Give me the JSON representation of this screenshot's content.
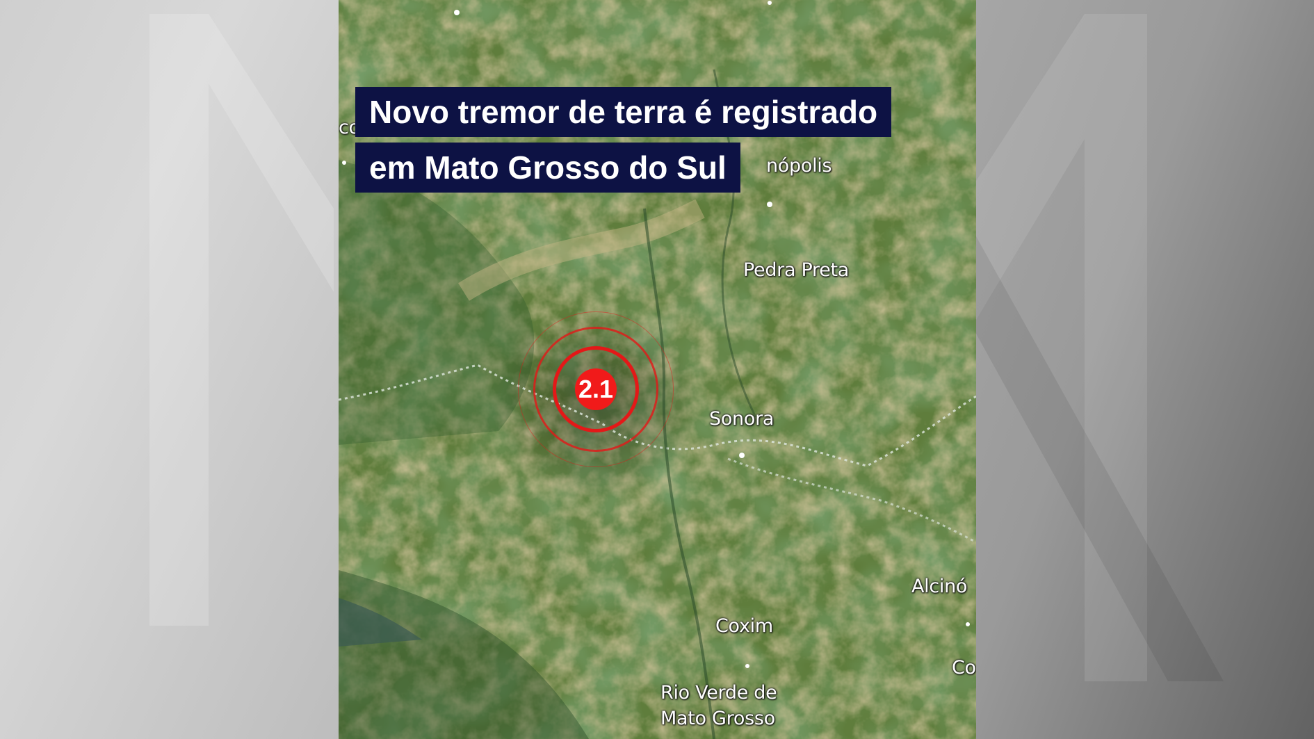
{
  "headline": {
    "line1": "Novo tremor de terra é registrado",
    "line2": "em Mato Grosso do Sul"
  },
  "earthquake": {
    "magnitude": "2.1",
    "marker_color": "#f11a1a"
  },
  "places": {
    "rondonopolis_partial": "nópolis",
    "pedra_preta": "Pedra Preta",
    "sonora": "Sonora",
    "alcinopolis_partial": "Alcinó",
    "coxim": "Coxim",
    "rio_verde_line1": "Rio Verde de",
    "rio_verde_line2": "Mato Grosso",
    "edge_left_partial": "co",
    "edge_right_partial": "Co"
  },
  "colors": {
    "headline_bg": "#0d1244",
    "map_green": "#5a7a3a"
  }
}
